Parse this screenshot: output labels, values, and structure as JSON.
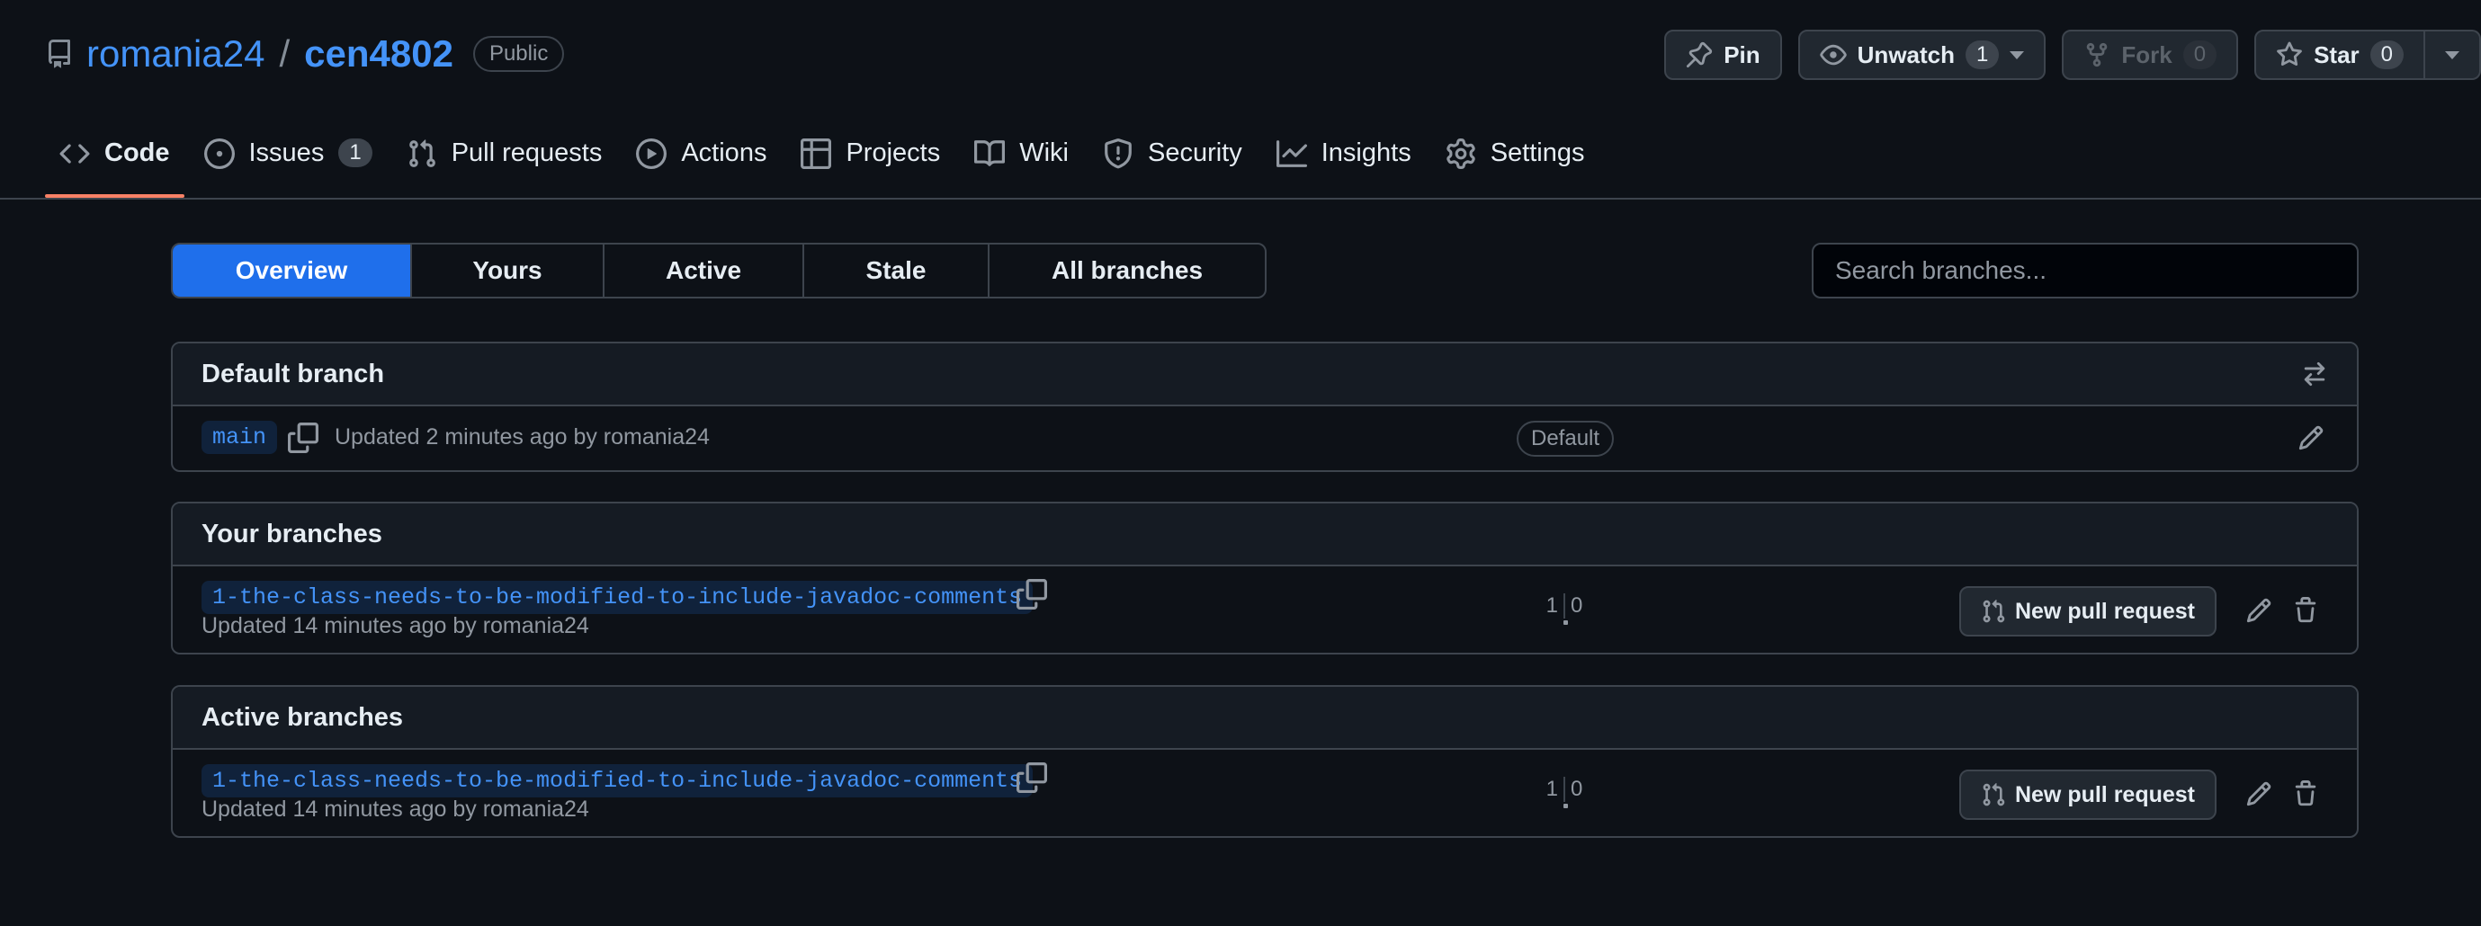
{
  "repo": {
    "owner": "romania24",
    "separator": "/",
    "name": "cen4802",
    "visibility": "Public"
  },
  "header_actions": {
    "pin": "Pin",
    "unwatch": "Unwatch",
    "watch_count": "1",
    "fork": "Fork",
    "fork_count": "0",
    "star": "Star",
    "star_count": "0"
  },
  "nav": {
    "code": "Code",
    "issues": "Issues",
    "issues_count": "1",
    "pull_requests": "Pull requests",
    "actions": "Actions",
    "projects": "Projects",
    "wiki": "Wiki",
    "security": "Security",
    "insights": "Insights",
    "settings": "Settings"
  },
  "subnav": {
    "overview": "Overview",
    "yours": "Yours",
    "active": "Active",
    "stale": "Stale",
    "all": "All branches"
  },
  "search": {
    "placeholder": "Search branches..."
  },
  "default_section": {
    "title": "Default branch",
    "branch": "main",
    "updated": "Updated 2 minutes ago by romania24",
    "badge": "Default"
  },
  "your_section": {
    "title": "Your branches",
    "branch": "1-the-class-needs-to-be-modified-to-include-javadoc-comments",
    "updated": "Updated 14 minutes ago by romania24",
    "behind": "1",
    "ahead": "0",
    "button": "New pull request"
  },
  "active_section": {
    "title": "Active branches",
    "branch": "1-the-class-needs-to-be-modified-to-include-javadoc-comments",
    "updated": "Updated 14 minutes ago by romania24",
    "behind": "1",
    "ahead": "0",
    "button": "New pull request"
  },
  "colors": {
    "accent": "#4493f8",
    "selected_tab": "#1f6feb",
    "underline": "#f78166",
    "background": "#0d1117"
  },
  "icons": [
    "repo-icon",
    "pin-icon",
    "eye-icon",
    "fork-icon",
    "star-icon",
    "code-icon",
    "issue-icon",
    "pull-request-icon",
    "play-icon",
    "table-icon",
    "book-icon",
    "shield-icon",
    "graph-icon",
    "gear-icon",
    "copy-icon",
    "switch-icon",
    "pencil-icon",
    "trash-icon"
  ]
}
